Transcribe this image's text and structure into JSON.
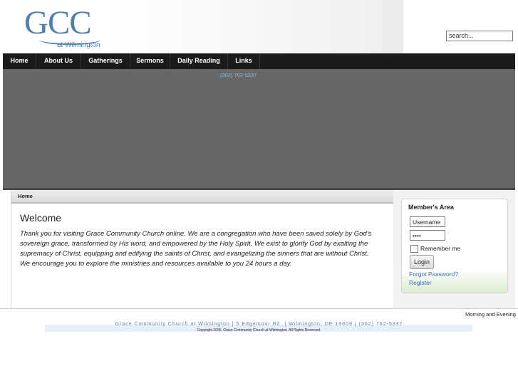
{
  "logo": {
    "main": "GCC",
    "sub": "at Wilmington"
  },
  "search": {
    "placeholder": "search..."
  },
  "nav": {
    "items": [
      "Home",
      "About Us",
      "Gatherings",
      "Sermons",
      "Daily Reading",
      "Links"
    ]
  },
  "hero": {
    "phone": "(302) 762-5337"
  },
  "breadcrumb": "Home",
  "welcome": {
    "title": "Welcome",
    "text": "Thank you for visiting Grace Community Church online. We are a congregation who have been saved solely by God's sovereign grace, transformed by His word, and empowered by the Holy Spirit. We exist to glorify God by exalting the supremacy of Christ, equipping and edifying the saints of Christ, and evangelizing the sinners that are without Christ.  We encourage you to explore the ministries and resources available to you 24 hours a day."
  },
  "members": {
    "title": "Member's Area",
    "username": "Username",
    "password": "••••",
    "remember": "Remember me",
    "login": "Login",
    "forgot": "Forgot Password?",
    "register": "Register"
  },
  "tagline": "Morning and Evening",
  "footer": {
    "address": "Grace Community Church at Wilmington  |  5 Edgemoor Rd.  |  Wilmington, DE 19809  |  (302) 762-5337",
    "copyright": "Copyright 2006, Grace Community Church at Wilmington. All Rights Reserved."
  }
}
